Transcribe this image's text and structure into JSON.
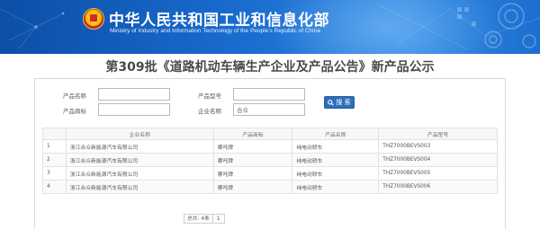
{
  "site": {
    "title": "中华人民共和国工业和信息化部",
    "subtitle": "Ministry of Industry and Information Technology of the People's Republic of China"
  },
  "page_title": "第309批《道路机动车辆生产企业及产品公告》新产品公示",
  "form": {
    "product_name_label": "产品名称",
    "product_name_value": "",
    "product_model_label": "产品型号",
    "product_model_value": "",
    "product_brand_label": "产品商标",
    "product_brand_value": "",
    "enterprise_name_label": "企业名称",
    "enterprise_name_value": "合众",
    "search_label": "搜 索"
  },
  "table": {
    "headers": [
      "",
      "企业名称",
      "产品商标",
      "产品名称",
      "产品型号"
    ],
    "rows": [
      {
        "index": "1",
        "enterprise": "浙江合众新能源汽车有限公司",
        "brand": "哪吒牌",
        "name": "纯电动轿车",
        "model": "THZ7000BEVS003"
      },
      {
        "index": "2",
        "enterprise": "浙江合众新能源汽车有限公司",
        "brand": "哪吒牌",
        "name": "纯电动轿车",
        "model": "THZ7000BEVS004"
      },
      {
        "index": "3",
        "enterprise": "浙江合众新能源汽车有限公司",
        "brand": "哪吒牌",
        "name": "纯电动轿车",
        "model": "THZ7000BEVS005"
      },
      {
        "index": "4",
        "enterprise": "浙江合众新能源汽车有限公司",
        "brand": "哪吒牌",
        "name": "纯电动轿车",
        "model": "THZ7000BEVS006"
      }
    ]
  },
  "pagination": {
    "total_text": "总共: 4条",
    "current_page": "1"
  },
  "colors": {
    "banner_blue": "#1a6ccf",
    "button_blue": "#2f6fb7"
  },
  "icons": {
    "emblem": "national-emblem-icon",
    "search": "search-icon"
  }
}
